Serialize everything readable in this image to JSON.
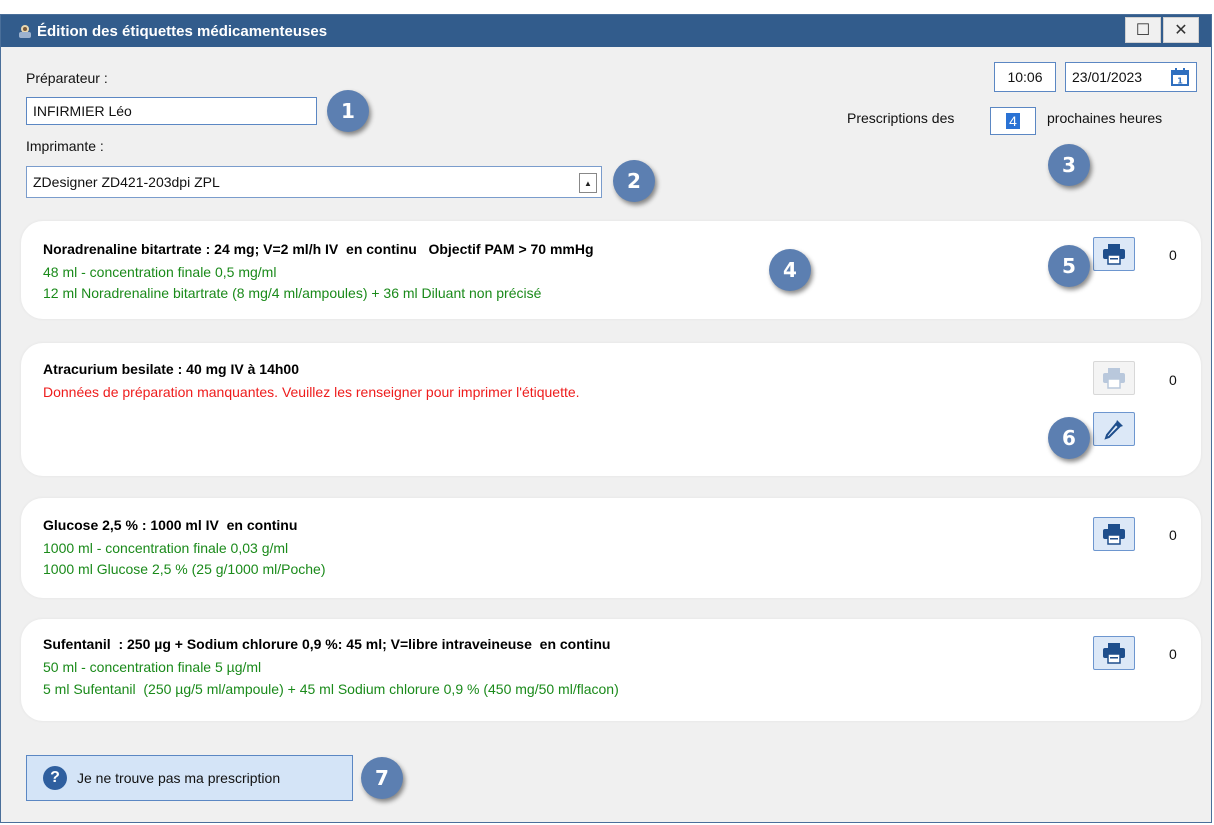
{
  "window": {
    "title": "Édition des étiquettes médicamenteuses",
    "maximize_glyph": "☐",
    "close_glyph": "✕"
  },
  "form": {
    "preparer_label": "Préparateur :",
    "preparer_value": "INFIRMIER Léo",
    "printer_label": "Imprimante :",
    "printer_value": "ZDesigner ZD421-203dpi ZPL",
    "time_value": "10:06",
    "date_value": "23/01/2023",
    "prescriptions_prefix": "Prescriptions des",
    "hours_value": "4",
    "prescriptions_suffix": "prochaines heures"
  },
  "badges": [
    "1",
    "2",
    "3",
    "4",
    "5",
    "6",
    "7"
  ],
  "prescriptions": [
    {
      "title": "Noradrenaline bitartrate : 24 mg; V=2 ml/h IV  en continu   Objectif PAM > 70 mmHg",
      "line1": "48 ml - concentration finale 0,5 mg/ml",
      "line2": "12 ml Noradrenaline bitartrate (8 mg/4 ml/ampoules) + 36 ml Diluant non précisé",
      "count": "0"
    },
    {
      "title": "Atracurium besilate : 40 mg IV à 14h00",
      "warning": "Données de préparation manquantes. Veuillez les renseigner pour imprimer l'étiquette.",
      "count": "0"
    },
    {
      "title": "Glucose 2,5 % : 1000 ml IV  en continu",
      "line1": "1000 ml - concentration finale 0,03 g/ml",
      "line2": "1000 ml Glucose 2,5 % (25 g/1000 ml/Poche)",
      "count": "0"
    },
    {
      "title": "Sufentanil  : 250 µg + Sodium chlorure 0,9 %: 45 ml; V=libre intraveineuse  en continu",
      "line1": "50 ml - concentration finale 5 µg/ml",
      "line2": "5 ml Sufentanil  (250 µg/5 ml/ampoule) + 45 ml Sodium chlorure 0,9 % (450 mg/50 ml/flacon)",
      "count": "0"
    }
  ],
  "help_button": {
    "label": "Je ne trouve pas ma prescription",
    "icon_glyph": "?"
  },
  "colors": {
    "titlebar": "#325c8c",
    "badge": "#5c7fb1",
    "green_text": "#1a8a1a",
    "warning_text": "#ee1c1c",
    "button_fill": "#dce8f7"
  },
  "icons": [
    "app-icon",
    "maximize-icon",
    "close-icon",
    "dropdown-arrow-icon",
    "calendar-icon",
    "printer-icon",
    "pipette-icon",
    "help-icon"
  ]
}
